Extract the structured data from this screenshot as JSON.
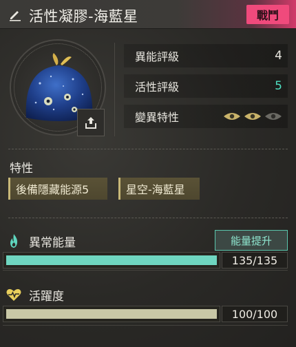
{
  "header": {
    "title": "活性凝膠-海藍星",
    "badge": "戰鬥",
    "accent": "#f04a7c"
  },
  "stats": [
    {
      "label": "異能評級",
      "value": "4",
      "color": "#e9e7e0"
    },
    {
      "label": "活性評級",
      "value": "5",
      "color": "#4fe0c2"
    },
    {
      "label": "變異特性",
      "value": null,
      "eyes_active": 2,
      "eyes_total": 3
    }
  ],
  "traits": {
    "title": "特性",
    "items": [
      "後備隱藏能源5",
      "星空-海藍星"
    ]
  },
  "energy": {
    "label": "異常能量",
    "action": "能量提升",
    "current": 135,
    "max": 135,
    "display": "135/135",
    "color": "#6fd6c0"
  },
  "vitality": {
    "label": "活躍度",
    "current": 100,
    "max": 100,
    "display": "100/100",
    "color": "#c9c8a6"
  },
  "icons": {
    "edit": "pencil-icon",
    "export": "share-upload-icon",
    "energy": "flame-icon",
    "vitality": "heart-pulse-icon",
    "trait_eye": "eye-icon"
  }
}
